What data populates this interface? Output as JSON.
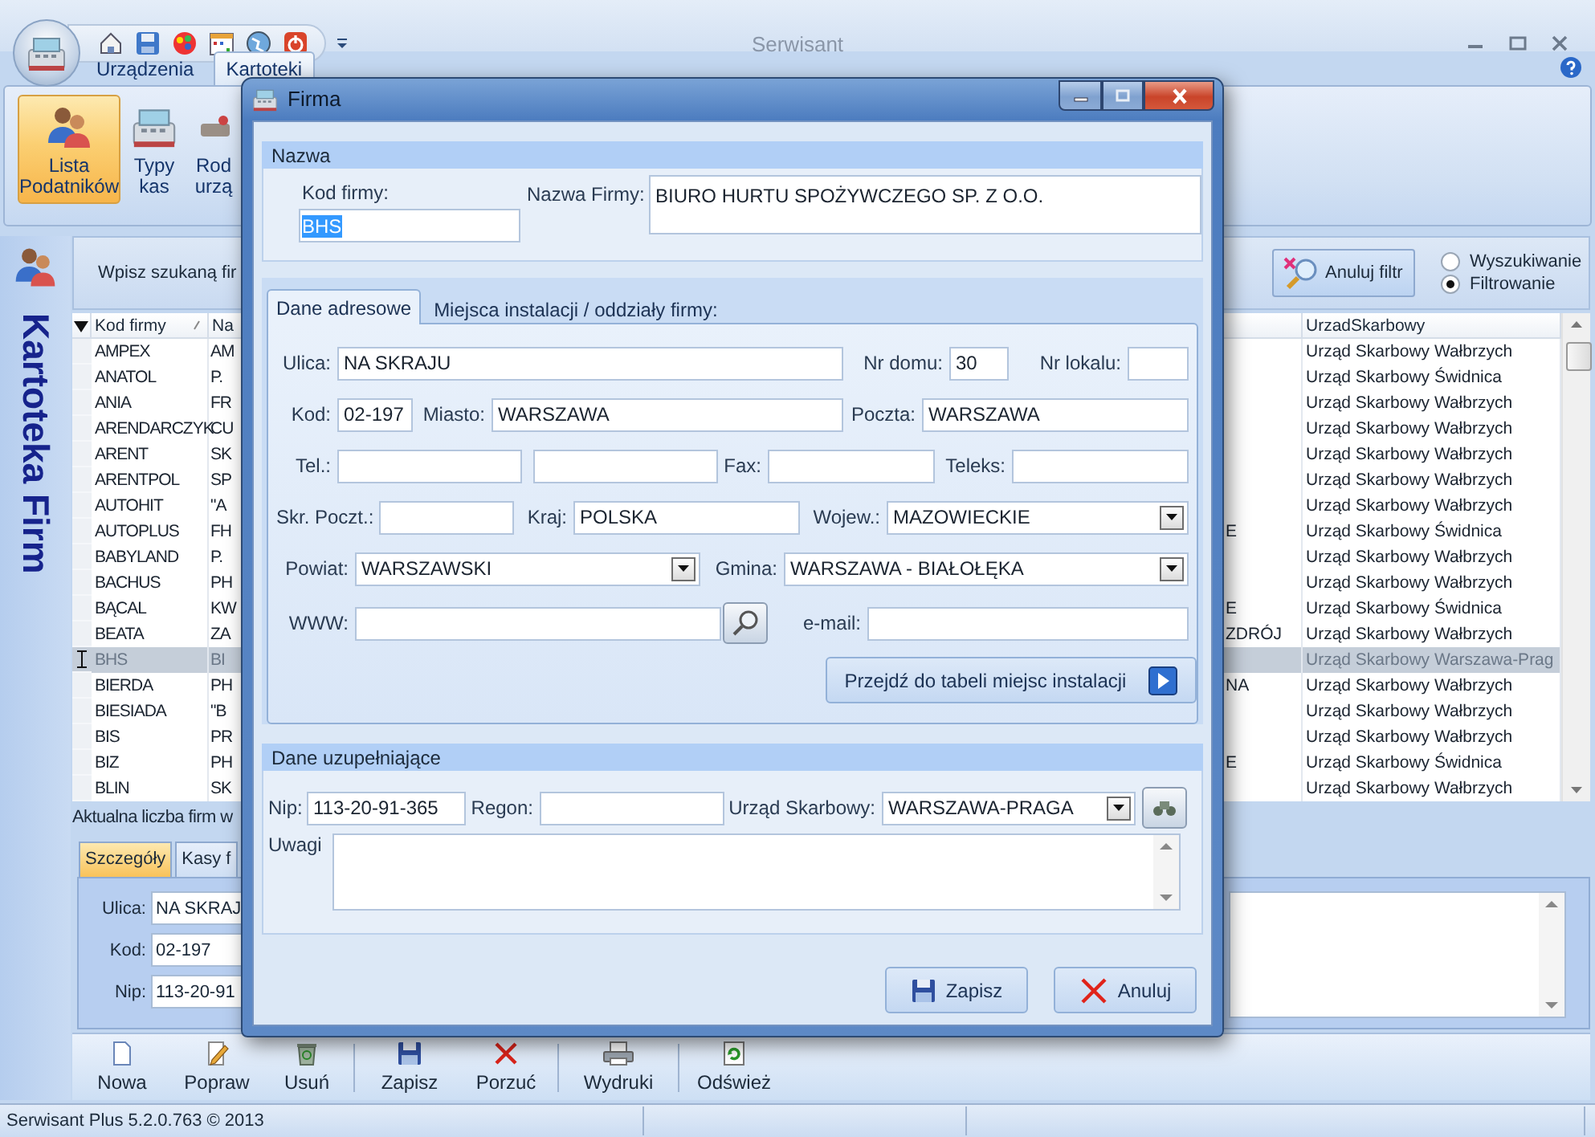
{
  "window": {
    "title": "Serwisant"
  },
  "ribbon": {
    "tabs": [
      {
        "label": "Urządzenia",
        "selected": false
      },
      {
        "label": "Kartoteki",
        "selected": true
      }
    ],
    "buttons": [
      {
        "lines": [
          "Lista",
          "Podatników"
        ],
        "selected": true
      },
      {
        "lines": [
          "Typy",
          "kas"
        ],
        "selected": false
      },
      {
        "lines": [
          "Rod",
          "urzą"
        ],
        "selected": false
      }
    ]
  },
  "sidebar": {
    "title": "Kartoteka Firm"
  },
  "search": {
    "label": "Wpisz szukaną fir",
    "clear_button": "Anuluj filtr",
    "modes": [
      {
        "label": "Wyszukiwanie",
        "selected": false
      },
      {
        "label": "Filtrowanie",
        "selected": true
      }
    ]
  },
  "table": {
    "columns": {
      "code": "Kod firmy",
      "column_2": "Na",
      "tax_office": "UrzadSkarbowy"
    },
    "rows": [
      {
        "code": "AMPEX",
        "column_2": "AM",
        "tax_office": "Urząd Skarbowy Wałbrzych",
        "selected": false
      },
      {
        "code": "ANATOL",
        "column_2": "P.",
        "tax_office": "Urząd Skarbowy Świdnica",
        "selected": false
      },
      {
        "code": "ANIA",
        "column_2": "FR",
        "tax_office": "Urząd Skarbowy Wałbrzych",
        "selected": false
      },
      {
        "code": "ARENDARCZYK",
        "column_2": "CU",
        "tax_office": "Urząd Skarbowy Wałbrzych",
        "selected": false
      },
      {
        "code": "ARENT",
        "column_2": "SK",
        "tax_office": "Urząd Skarbowy Wałbrzych",
        "selected": false
      },
      {
        "code": "ARENTPOL",
        "column_2": "SP",
        "tax_office": "Urząd Skarbowy Wałbrzych",
        "selected": false
      },
      {
        "code": "AUTOHIT",
        "column_2": "\"A",
        "tax_office": "Urząd Skarbowy Wałbrzych",
        "selected": false
      },
      {
        "code": "AUTOPLUS",
        "column_2": "FH",
        "column_3": "E",
        "tax_office": "Urząd Skarbowy Świdnica",
        "selected": false
      },
      {
        "code": "BABYLAND",
        "column_2": "P.",
        "tax_office": "Urząd Skarbowy Wałbrzych",
        "selected": false
      },
      {
        "code": "BACHUS",
        "column_2": "PH",
        "tax_office": "Urząd Skarbowy Wałbrzych",
        "selected": false
      },
      {
        "code": "BĄCAL",
        "column_2": "KW",
        "column_3": "E",
        "tax_office": "Urząd Skarbowy Świdnica",
        "selected": false
      },
      {
        "code": "BEATA",
        "column_2": "ZA",
        "column_3": "ZDRÓJ",
        "tax_office": "Urząd Skarbowy Wałbrzych",
        "selected": false
      },
      {
        "code": "BHS",
        "column_2": "BI",
        "tax_office": "Urząd Skarbowy Warszawa-Prag",
        "selected": true
      },
      {
        "code": "BIERDA",
        "column_2": "PH",
        "column_3": "NA",
        "tax_office": "Urząd Skarbowy Wałbrzych",
        "selected": false
      },
      {
        "code": "BIESIADA",
        "column_2": "\"B",
        "tax_office": "Urząd Skarbowy Wałbrzych",
        "selected": false
      },
      {
        "code": "BIS",
        "column_2": "PR",
        "tax_office": "Urząd Skarbowy Wałbrzych",
        "selected": false
      },
      {
        "code": "BIZ",
        "column_2": "PH",
        "column_3": "E",
        "tax_office": "Urząd Skarbowy Świdnica",
        "selected": false
      },
      {
        "code": "BLIN",
        "column_2": "SK",
        "tax_office": "Urząd Skarbowy Wałbrzych",
        "selected": false
      }
    ]
  },
  "record_count": "Aktualna liczba firm w",
  "detail_tabs": [
    {
      "label": "Szczegóły",
      "selected": true
    },
    {
      "label": "Kasy f",
      "selected": false
    }
  ],
  "details": [
    {
      "label": "Ulica:",
      "value": "NA SKRAJ"
    },
    {
      "label": "Kod:",
      "value": "02-197"
    },
    {
      "label": "Nip:",
      "value": "113-20-91"
    }
  ],
  "toolbar": [
    {
      "label": "Nowa"
    },
    {
      "label": "Popraw"
    },
    {
      "label": "Usuń"
    },
    {
      "label": "Zapisz"
    },
    {
      "label": "Porzuć"
    },
    {
      "label": "Wydruki"
    },
    {
      "label": "Odśwież"
    }
  ],
  "status_bar": {
    "version": "Serwisant Plus 5.2.0.763 © 2013"
  },
  "dialog": {
    "title": "Firma",
    "name_group": {
      "title": "Nazwa",
      "code": {
        "label": "Kod firmy:",
        "value": "BHS",
        "highlighted": true
      },
      "name": {
        "label": "Nazwa Firmy:",
        "value": "BIURO HURTU SPOŻYWCZEGO SP. Z O.O."
      }
    },
    "tabs": [
      {
        "label": "Dane adresowe",
        "selected": true
      },
      {
        "label": "Miejsca instalacji / oddziały firmy:",
        "selected": false
      }
    ],
    "address_rows": [
      [
        {
          "kind": "text",
          "label": "Ulica:",
          "value": "NA SKRAJU"
        },
        {
          "kind": "text",
          "label": "Nr domu:",
          "value": "30"
        },
        {
          "kind": "text",
          "label": "Nr lokalu:"
        }
      ],
      [
        {
          "kind": "text",
          "label": "Kod:",
          "value": "02-197"
        },
        {
          "kind": "text",
          "label": "Miasto:",
          "value": "WARSZAWA"
        },
        {
          "kind": "text",
          "label": "Poczta:",
          "value": "WARSZAWA"
        }
      ],
      [
        {
          "kind": "text",
          "label": "Tel.:"
        },
        {
          "kind": "text"
        },
        {
          "kind": "text",
          "label": "Fax:"
        },
        {
          "kind": "text",
          "label": "Teleks:"
        }
      ],
      [
        {
          "kind": "text",
          "label": "Skr. Poczt.:"
        },
        {
          "kind": "text",
          "label": "Kraj:",
          "value": "POLSKA"
        },
        {
          "kind": "dropdown",
          "label": "Wojew.:",
          "value": "MAZOWIECKIE"
        }
      ],
      [
        {
          "kind": "dropdown",
          "label": "Powiat:",
          "value": "WARSZAWSKI"
        },
        {
          "kind": "dropdown",
          "label": "Gmina:",
          "value": "WARSZAWA - BIAŁOŁĘKA"
        }
      ],
      [
        {
          "kind": "search",
          "label": "WWW:"
        },
        {
          "kind": "text",
          "label": "e-mail:"
        }
      ]
    ],
    "goto_button": "Przejdź do tabeli miejsc instalacji",
    "extra_group": {
      "title": "Dane uzupełniające",
      "fields": [
        {
          "kind": "text",
          "label": "Nip:",
          "value": "113-20-91-365"
        },
        {
          "kind": "text",
          "label": "Regon:"
        },
        {
          "kind": "lookup",
          "label": "Urząd Skarbowy:",
          "value": "WARSZAWA-PRAGA"
        }
      ],
      "notes": {
        "label": "Uwagi"
      }
    },
    "buttons": [
      {
        "kind": "save",
        "label": "Zapisz"
      },
      {
        "kind": "cancel",
        "label": "Anuluj"
      }
    ]
  }
}
